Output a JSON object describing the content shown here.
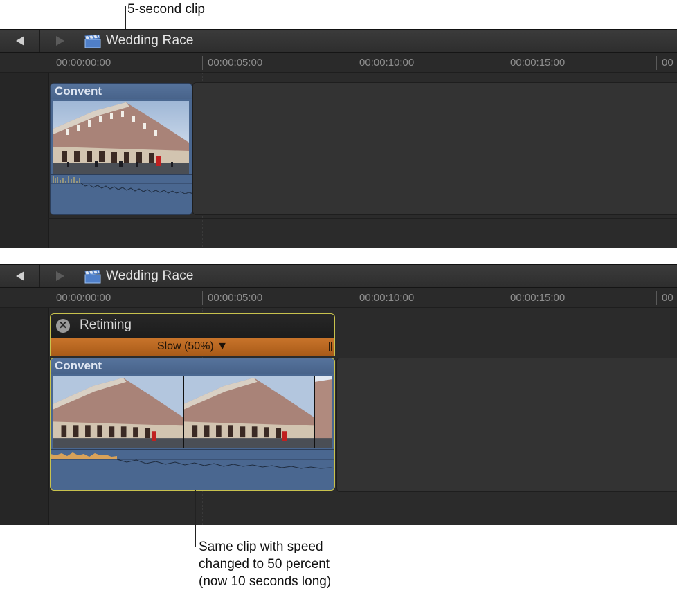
{
  "callouts": {
    "top": "5-second clip",
    "bottom_line1": "Same clip with speed",
    "bottom_line2": "changed to 50 percent",
    "bottom_line3": "(now 10 seconds long)"
  },
  "timeline_top": {
    "project_title": "Wedding Race",
    "timecodes": [
      "00:00:00:00",
      "00:00:05:00",
      "00:00:10:00",
      "00:00:15:00",
      "00"
    ],
    "clip": {
      "name": "Convent"
    }
  },
  "timeline_bottom": {
    "project_title": "Wedding Race",
    "timecodes": [
      "00:00:00:00",
      "00:00:05:00",
      "00:00:10:00",
      "00:00:15:00",
      "00"
    ],
    "retiming": {
      "title": "Retiming",
      "close_glyph": "✕",
      "speed_label": "Slow (50%) ▼",
      "speed_percent": 50
    },
    "clip": {
      "name": "Convent"
    }
  },
  "icons": [
    "back-arrow-icon",
    "forward-arrow-icon",
    "clapperboard-icon",
    "close-icon",
    "building-thumbnail"
  ],
  "colors": {
    "clip_blue": "#4a6790",
    "retime_orange": "#b8661f",
    "selection_yellow": "#c8c24d",
    "panel_dark": "#2b2b2b"
  }
}
